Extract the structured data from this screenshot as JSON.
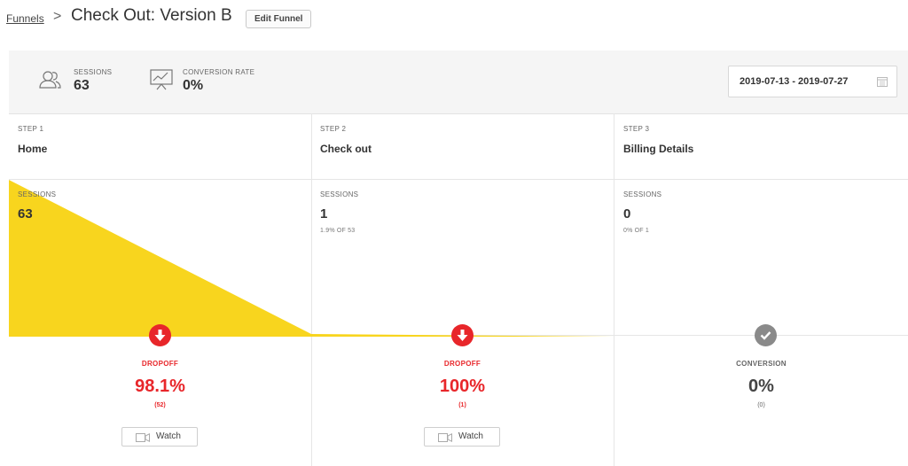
{
  "breadcrumb": {
    "parent": "Funnels",
    "separator": ">"
  },
  "page": {
    "title": "Check Out: Version B",
    "edit_label": "Edit Funnel"
  },
  "summary": {
    "sessions_label": "SESSIONS",
    "sessions_value": "63",
    "conversion_label": "CONVERSION RATE",
    "conversion_value": "0%",
    "date_range": "2019-07-13 - 2019-07-27"
  },
  "steps": [
    {
      "step": "STEP 1",
      "name": "Home",
      "sessions_label": "SESSIONS",
      "sessions": "63",
      "sub": "",
      "outcome_label": "DROPOFF",
      "outcome_pct": "98.1%",
      "outcome_count": "(52)",
      "watch": "Watch"
    },
    {
      "step": "STEP 2",
      "name": "Check out",
      "sessions_label": "SESSIONS",
      "sessions": "1",
      "sub": "1.9% OF 53",
      "outcome_label": "DROPOFF",
      "outcome_pct": "100%",
      "outcome_count": "(1)",
      "watch": "Watch"
    },
    {
      "step": "STEP 3",
      "name": "Billing Details",
      "sessions_label": "SESSIONS",
      "sessions": "0",
      "sub": "0% OF 1",
      "outcome_label": "CONVERSION",
      "outcome_pct": "0%",
      "outcome_count": "(0)"
    }
  ],
  "colors": {
    "funnel": "#f8d51e",
    "dropoff": "#e8262a",
    "conversion": "#8a8a8a"
  },
  "icons": {
    "sessions": "users-icon",
    "conversion": "presentation-chart-icon",
    "calendar": "calendar-icon",
    "dropoff": "arrow-down-circle-icon",
    "conversion_check": "check-circle-icon",
    "watch": "video-camera-icon"
  }
}
